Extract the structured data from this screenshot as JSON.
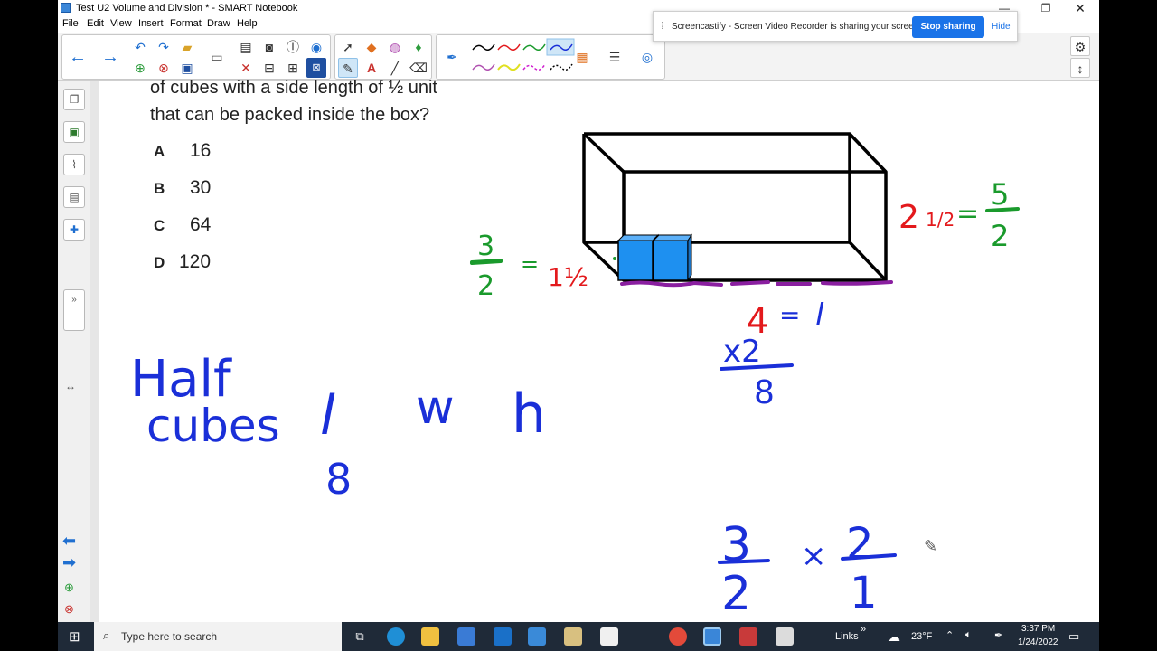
{
  "window": {
    "title": "Test U2 Volume and Division * - SMART Notebook"
  },
  "menu": [
    "File",
    "Edit",
    "View",
    "Insert",
    "Format",
    "Draw",
    "Help"
  ],
  "screencastify": {
    "message": "Screencastify - Screen Video Recorder is sharing your screen.",
    "stop_label": "Stop sharing",
    "hide_label": "Hide"
  },
  "question": {
    "line1": "of cubes with a side length of ½ unit",
    "line2": "that can be packed inside the box?",
    "options": [
      {
        "letter": "A",
        "value": "16"
      },
      {
        "letter": "B",
        "value": "30"
      },
      {
        "letter": "C",
        "value": "64"
      },
      {
        "letter": "D",
        "value": "120"
      }
    ]
  },
  "handwriting": {
    "half": "Half",
    "cubes": "cubes",
    "l": "l",
    "w": "w",
    "h": "h",
    "eight_under_l": "8",
    "left_frac_num": "3",
    "left_frac_den": "2",
    "equals": "=",
    "left_mixed": "1½",
    "right_mixed_whole": "2",
    "right_mixed_frac": "1/2",
    "right_frac_num": "5",
    "right_frac_den": "2",
    "length_label": "4",
    "length_var": "l",
    "times2": "x2",
    "result8": "8",
    "calc_a_num": "3",
    "calc_a_den": "2",
    "calc_times": "×",
    "calc_b_num": "2",
    "calc_b_den": "1"
  },
  "colors": {
    "blue_ink": "#1a2fd8",
    "red_ink": "#e3191c",
    "green_ink": "#1a9a2c",
    "purple_ink": "#8a1fa0",
    "cube_fill": "#1e90f0"
  },
  "taskbar": {
    "search_placeholder": "Type here to search",
    "links_label": "Links",
    "links_chevron": "»",
    "weather": "23°F",
    "time": "3:37 PM",
    "date": "1/24/2022"
  }
}
